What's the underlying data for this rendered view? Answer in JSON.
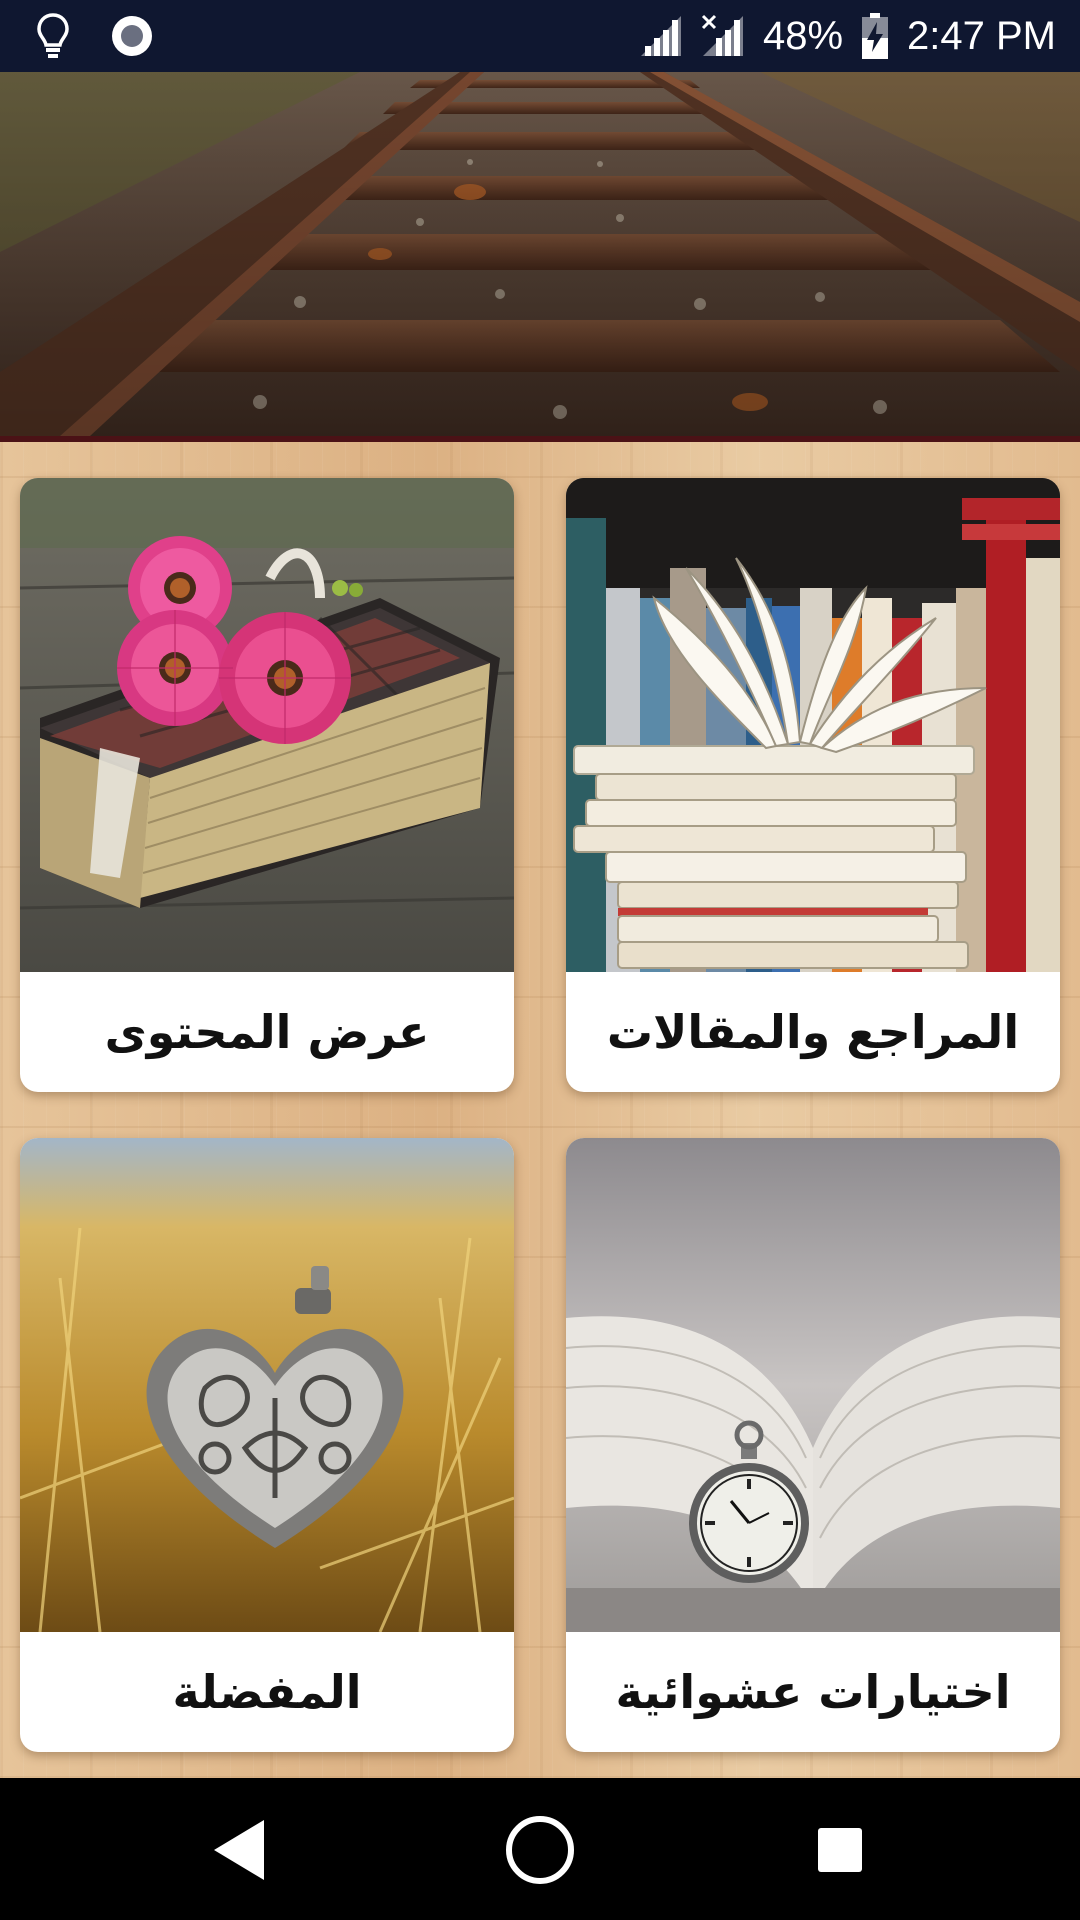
{
  "status_bar": {
    "icons_left": [
      "lightbulb-icon",
      "record-icon"
    ],
    "icons_right": [
      "signal-icon",
      "signal-no-data-icon",
      "battery-charging-icon"
    ],
    "battery": "48%",
    "time": "2:47 PM"
  },
  "header": {
    "image": "railway-tracks-image"
  },
  "cards": [
    {
      "label": "المراجع والمقالات",
      "image": "stacked-books-image"
    },
    {
      "label": "عرض المحتوى",
      "image": "book-with-flowers-image"
    },
    {
      "label": "اختيارات عشوائية",
      "image": "book-with-pocket-watch-image"
    },
    {
      "label": "المفضلة",
      "image": "heart-locket-image"
    }
  ],
  "nav_bar": {
    "back": "back-icon",
    "home": "home-icon",
    "recents": "recents-icon"
  },
  "colors": {
    "status_bar": "#0f1730",
    "nav_bar": "#000000",
    "card_bg": "#ffffff",
    "header_border": "#4b1216"
  }
}
